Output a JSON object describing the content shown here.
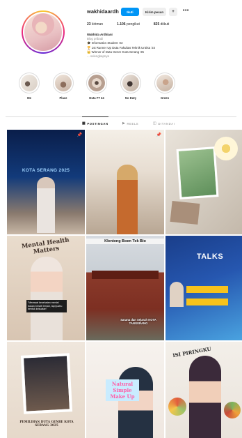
{
  "profile": {
    "username": "wakhidaardh",
    "follow_label": "Ikuti",
    "message_label": "Kirim pesan",
    "add_label": "+",
    "more_label": "•••",
    "stats": {
      "posts_count": "23",
      "posts_label": "kiriman",
      "followers_count": "1.106",
      "followers_label": "pengikut",
      "following_count": "825",
      "following_label": "diikuti"
    },
    "bio": {
      "name": "Wakhida Ardhiani",
      "category": "Blog pribadi",
      "line1": "🎓 Informatics Student '23",
      "line2": "🏆 1st Runner Up Duta Fakultas Teknik Untirta '24",
      "line3": "👑 Winner of Duta Genre Kota Serang '25",
      "more": "... selengkapnya"
    }
  },
  "highlights": [
    {
      "label": "Me"
    },
    {
      "label": "Place"
    },
    {
      "label": "Duta FT 24"
    },
    {
      "label": "No Duty"
    },
    {
      "label": "Green"
    }
  ],
  "tabs": {
    "posts": "POSTINGAN",
    "reels": "REELS",
    "tagged": "DITANDAI"
  },
  "posts": [
    {
      "overlay": "KOTA SERANG 2025"
    },
    {
      "overlay": ""
    },
    {
      "overlay": ""
    },
    {
      "overlay": "Mental Health Matters",
      "caption": "\"Merawat kesehatan mental bukan berarti lemah, tapi justru bentuk kekuatan\""
    },
    {
      "overlay": "Klenteng Boen Tek Bio",
      "caption": "Sarana dan Sejarah KOTA TANGERANG"
    },
    {
      "overlay": "TALKS"
    },
    {
      "overlay": "PEMILIHAN DUTA GENRE KOTA SERANG 2025"
    },
    {
      "overlay": "Natural Simple Make Up"
    },
    {
      "overlay": "ISI PIRINGKU"
    }
  ],
  "colors": {
    "accent": "#0095f6",
    "text": "#262626",
    "muted": "#8e8e8e",
    "divider": "#dbdbdb"
  }
}
